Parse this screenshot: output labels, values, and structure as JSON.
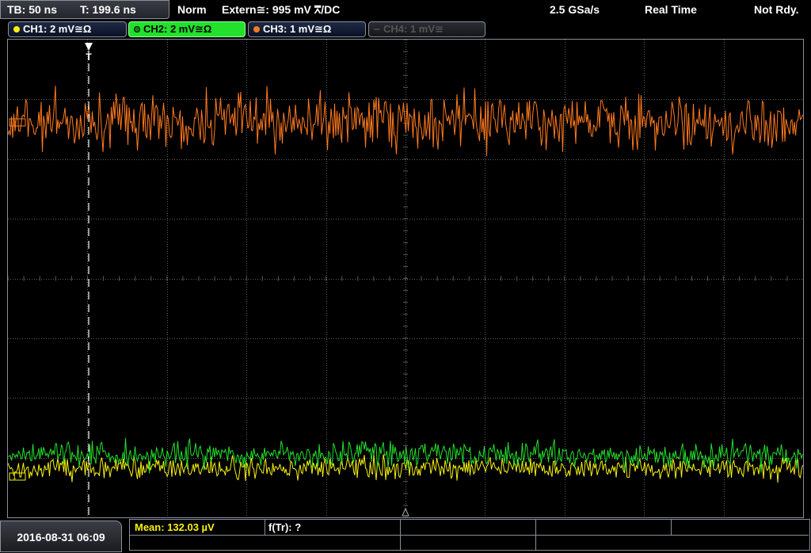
{
  "header": {
    "timebase": "TB: 50 ns",
    "trigger_time": "T: 199.6 ns",
    "acq_mode": "Norm",
    "trigger_source": "Extern≅: 995 mV ⩞/DC",
    "sample_rate": "2.5 GSa/s",
    "mode": "Real Time",
    "status": "Not Rdy."
  },
  "channels": [
    {
      "label": "CH1: 2 mV≅Ω",
      "color": "#f7f20a",
      "state": "on"
    },
    {
      "label": "CH2: 2 mV≅Ω",
      "color": "#22e02c",
      "state": "selected"
    },
    {
      "label": "CH3: 1 mV≅Ω",
      "color": "#ff7a1e",
      "state": "on"
    },
    {
      "label": "CH4: 1 mV≅",
      "color": "#555555",
      "state": "off"
    }
  ],
  "markers": {
    "trigger": "T",
    "ref_ch3": "3",
    "ref_ch1": "1"
  },
  "footer": {
    "datetime": "2016-08-31 06:09",
    "measurement": "Mean: 132.03 µV",
    "counter": "f(Tr): ?"
  },
  "colors": {
    "grid": "#5a5a5a",
    "ch3": "#ff7a1e",
    "ch2": "#22e02c",
    "ch1": "#f7f20a"
  }
}
